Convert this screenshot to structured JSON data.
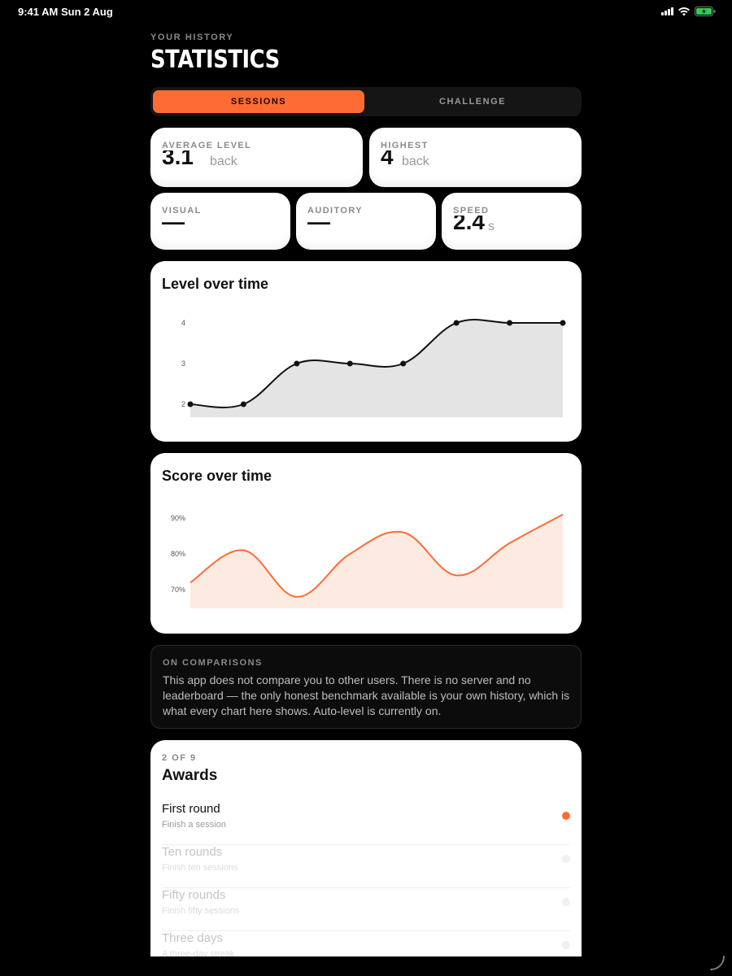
{
  "status_bar": {
    "time": "9:41 AM  Sun 2 Aug"
  },
  "header": {
    "eyebrow": "YOUR HISTORY",
    "title": "STATISTICS"
  },
  "tabs": [
    {
      "label": "SESSIONS",
      "active": true
    },
    {
      "label": "CHALLENGE",
      "active": false
    }
  ],
  "stats": {
    "average_level": {
      "label": "AVERAGE LEVEL",
      "value": "3.1",
      "unit": "back"
    },
    "highest": {
      "label": "HIGHEST",
      "value": "4",
      "unit": "back"
    },
    "visual": {
      "label": "VISUAL",
      "value": "—"
    },
    "auditory": {
      "label": "AUDITORY",
      "value": "—"
    },
    "speed": {
      "label": "SPEED",
      "value": "2.4",
      "unit": "s"
    }
  },
  "chart_data": [
    {
      "type": "line",
      "title": "Level over time",
      "x": [
        1,
        2,
        3,
        4,
        5,
        6,
        7,
        8
      ],
      "values": [
        2,
        2,
        3,
        3,
        3,
        4,
        4,
        4
      ],
      "yticks": [
        "2",
        "3",
        "4"
      ],
      "ylim": [
        2,
        4
      ],
      "color": "#111111",
      "fill": "#e4e4e4",
      "markers": true
    },
    {
      "type": "area",
      "title": "Score over time",
      "x": [
        1,
        2,
        3,
        4,
        5,
        6,
        7,
        8
      ],
      "values": [
        72,
        81,
        68,
        80,
        86,
        74,
        83,
        91
      ],
      "yticks": [
        "70%",
        "80%",
        "90%"
      ],
      "ylim": [
        70,
        90
      ],
      "color": "#ff6b35",
      "fill": "#fdebe2",
      "markers": false
    }
  ],
  "comparisons": {
    "title": "ON COMPARISONS",
    "body": "This app does not compare you to other users. There is no server and no leaderboard — the only honest benchmark available is your own history, which is what every chart here shows. Auto-level is currently on."
  },
  "awards": {
    "count": "2 OF 9",
    "title": "Awards",
    "items": [
      {
        "name": "First round",
        "description": "Finish a session",
        "earned": true
      },
      {
        "name": "Ten rounds",
        "description": "Finish ten sessions",
        "earned": false
      },
      {
        "name": "Fifty rounds",
        "description": "Finish fifty sessions",
        "earned": false
      },
      {
        "name": "Three days",
        "description": "A three-day streak",
        "earned": false
      }
    ]
  },
  "colors": {
    "accent": "#ff6b35",
    "background": "#000000",
    "card": "#ffffff"
  }
}
